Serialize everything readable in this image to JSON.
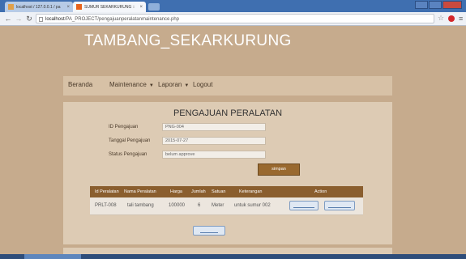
{
  "browser": {
    "tabs": [
      {
        "label": "localhost / 127.0.0.1 / pa"
      },
      {
        "label": "SUMUR SEKARKURUNG ::"
      }
    ],
    "url_host": "localhost",
    "url_path": "/PA_PROJECT/pengajuanperalatanmaintenance.php"
  },
  "site": {
    "title": "TAMBANG_SEKARKURUNG"
  },
  "nav": {
    "beranda": "Beranda",
    "maintenance": "Maintenance",
    "laporan": "Laporan",
    "logout": "Logout"
  },
  "form": {
    "title": "PENGAJUAN PERALATAN",
    "id_label": "ID Pengajuan",
    "id_value": "PNG-004",
    "tanggal_label": "Tanggal Pengajuan",
    "tanggal_value": "2015-07-27",
    "status_label": "Status Pengajuan",
    "status_value": "belum approve",
    "save_label": "simpan"
  },
  "table": {
    "headers": [
      "Id Peralatan",
      "Nama Peralatan",
      "Harga",
      "Jumlah",
      "Satuan",
      "Keterangan",
      "Action"
    ],
    "rows": [
      [
        "PRLT-008",
        "tali tambang",
        "100000",
        "6",
        "Meter",
        "untuk sumur 002"
      ]
    ]
  },
  "colors": {
    "page_bg": "#c6ab8d",
    "header_brown": "#8a5e2e",
    "button_brown": "#99692f"
  }
}
